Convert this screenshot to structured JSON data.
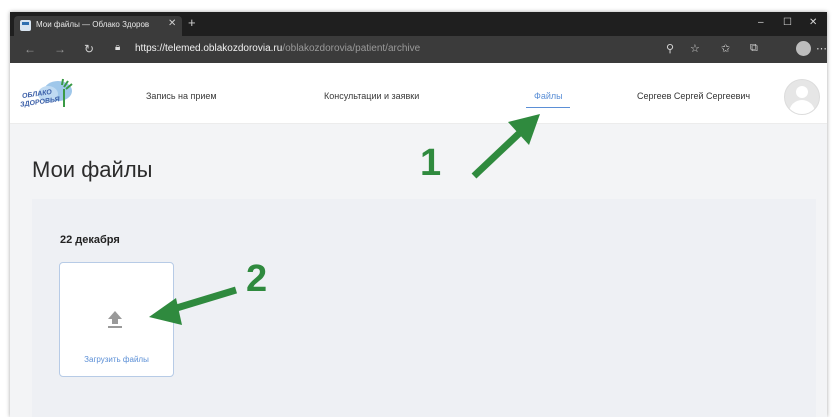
{
  "browser": {
    "tab_title": "Мои файлы — Облако Здоров",
    "tab_close": "✕",
    "new_tab": "+",
    "url_main": "https://telemed.oblakozdorovia.ru",
    "url_rest": "/oblakozdorovia/patient/archive",
    "window_controls": [
      "–",
      "☐",
      "✕"
    ]
  },
  "site": {
    "logo_line1": "ОБЛАКО",
    "logo_line2": "ЗДОРОВЬЯ",
    "nav": [
      {
        "label": "Запись на прием"
      },
      {
        "label": "Консультации и заявки"
      },
      {
        "label": "Файлы"
      }
    ],
    "user_name": "Сергеев Сергей Сергеевич"
  },
  "main": {
    "page_title": "Мои файлы",
    "date": "22 декабря",
    "upload_label": "Загрузить файлы"
  },
  "annotations": {
    "step1": "1",
    "step2": "2",
    "color": "#2f8a3e"
  },
  "colors": {
    "accent": "#5b8fd6",
    "tabbar": "#1f1f1f",
    "addressbar": "#3b3b3b"
  }
}
